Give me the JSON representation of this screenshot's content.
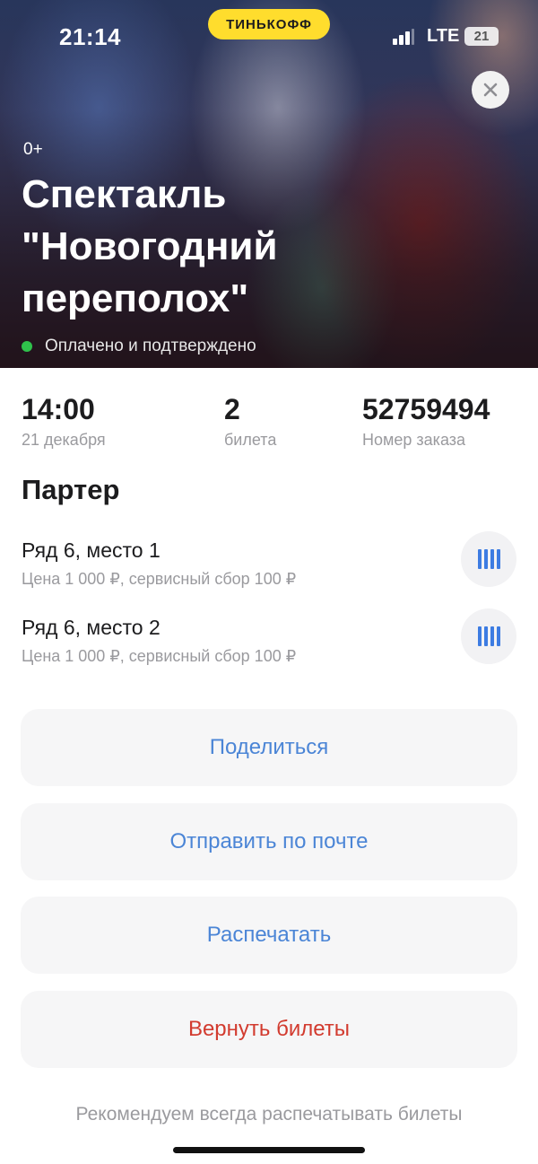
{
  "status_bar": {
    "time": "21:14",
    "brand": "ТИНЬКОФФ",
    "network": "LTE",
    "battery": "21",
    "signal_icon": "signal-bars-icon"
  },
  "hero": {
    "age_rating": "0+",
    "title": "Спектакль \"Новогодний переполох\"",
    "status": "Оплачено и подтверждено",
    "status_color": "#2fc14b",
    "close_icon": "close-icon"
  },
  "stats": {
    "time": {
      "value": "14:00",
      "label": "21 декабря"
    },
    "tickets": {
      "value": "2",
      "label": "билета"
    },
    "order": {
      "value": "52759494",
      "label": "Номер заказа"
    }
  },
  "section": {
    "title": "Партер"
  },
  "seats": [
    {
      "name": "Ряд 6, место 1",
      "price": "Цена 1 000 ₽, сервисный сбор 100 ₽",
      "icon": "barcode-icon"
    },
    {
      "name": "Ряд 6, место 2",
      "price": "Цена 1 000 ₽, сервисный сбор 100 ₽",
      "icon": "barcode-icon"
    }
  ],
  "actions": {
    "share": "Поделиться",
    "email": "Отправить по почте",
    "print": "Распечатать",
    "refund": "Вернуть билеты"
  },
  "footnote": "Рекомендуем всегда распечатывать билеты",
  "colors": {
    "brand_yellow": "#ffdd2d",
    "link_blue": "#4b85d6",
    "danger_red": "#d23b2f"
  }
}
